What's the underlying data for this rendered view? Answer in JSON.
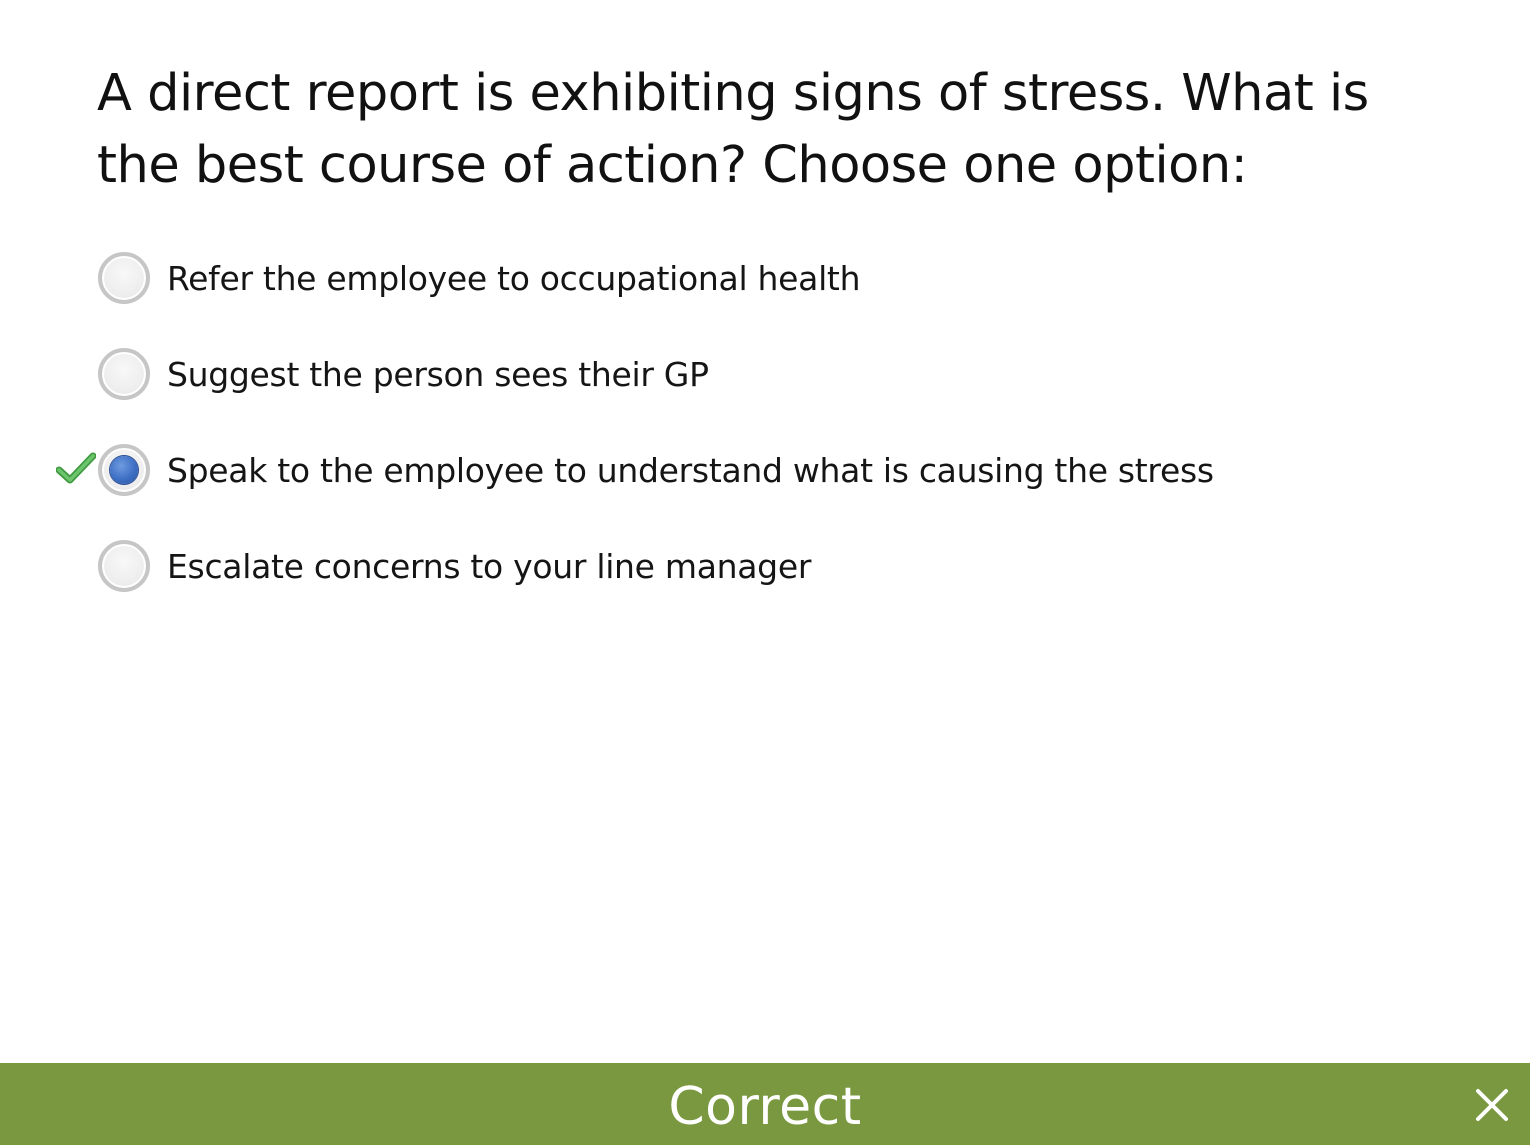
{
  "question": {
    "text": "A direct report is exhibiting signs of stress. What is the best course of action? Choose one option:"
  },
  "options": [
    {
      "label": "Refer the employee to occupational health",
      "selected": false,
      "marked_correct": false
    },
    {
      "label": "Suggest the person sees their GP",
      "selected": false,
      "marked_correct": false
    },
    {
      "label": "Speak to the employee to understand what is causing the stress",
      "selected": true,
      "marked_correct": true
    },
    {
      "label": "Escalate concerns to your line manager",
      "selected": false,
      "marked_correct": false
    }
  ],
  "feedback": {
    "text": "Correct",
    "close_icon": "close-icon",
    "bar_color": "#7a983f"
  },
  "icons": {
    "correct_marker": "checkmark-icon",
    "selected_color": "#3d6fc4",
    "check_color": "#4caf50"
  }
}
